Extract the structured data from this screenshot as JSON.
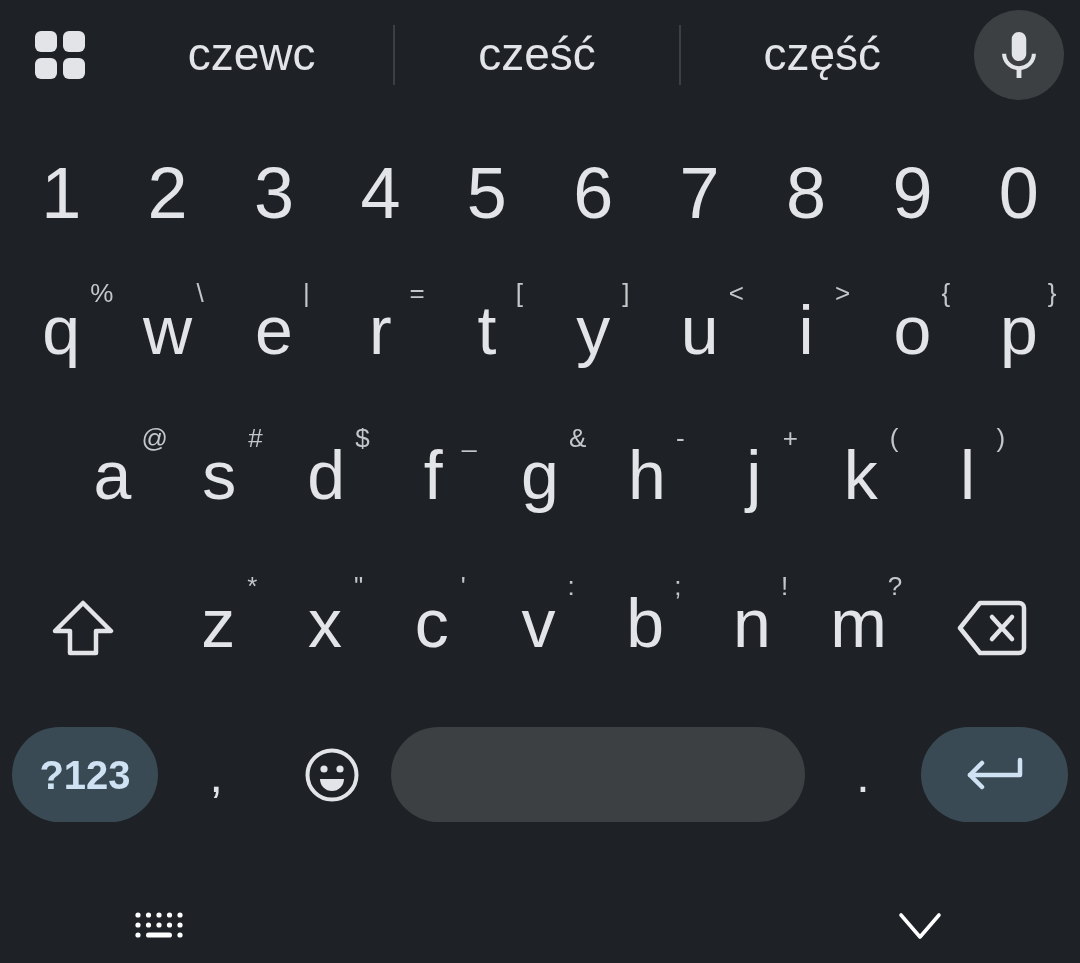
{
  "suggestion_strip": {
    "suggestions": [
      {
        "text": "czewc"
      },
      {
        "text": "cześć"
      },
      {
        "text": "część"
      }
    ]
  },
  "rows": [
    [
      {
        "kind": "digit",
        "label": "1"
      },
      {
        "kind": "digit",
        "label": "2"
      },
      {
        "kind": "digit",
        "label": "3"
      },
      {
        "kind": "digit",
        "label": "4"
      },
      {
        "kind": "digit",
        "label": "5"
      },
      {
        "kind": "digit",
        "label": "6"
      },
      {
        "kind": "digit",
        "label": "7"
      },
      {
        "kind": "digit",
        "label": "8"
      },
      {
        "kind": "digit",
        "label": "9"
      },
      {
        "kind": "digit",
        "label": "0"
      }
    ],
    [
      {
        "kind": "letter",
        "label": "q",
        "hint": "%"
      },
      {
        "kind": "letter",
        "label": "w",
        "hint": "\\"
      },
      {
        "kind": "letter",
        "label": "e",
        "hint": "|"
      },
      {
        "kind": "letter",
        "label": "r",
        "hint": "="
      },
      {
        "kind": "letter",
        "label": "t",
        "hint": "["
      },
      {
        "kind": "letter",
        "label": "y",
        "hint": "]"
      },
      {
        "kind": "letter",
        "label": "u",
        "hint": "<"
      },
      {
        "kind": "letter",
        "label": "i",
        "hint": ">"
      },
      {
        "kind": "letter",
        "label": "o",
        "hint": "{"
      },
      {
        "kind": "letter",
        "label": "p",
        "hint": "}"
      }
    ],
    [
      {
        "kind": "letter",
        "label": "a",
        "hint": "@"
      },
      {
        "kind": "letter",
        "label": "s",
        "hint": "#"
      },
      {
        "kind": "letter",
        "label": "d",
        "hint": "$"
      },
      {
        "kind": "letter",
        "label": "f",
        "hint": "_"
      },
      {
        "kind": "letter",
        "label": "g",
        "hint": "&"
      },
      {
        "kind": "letter",
        "label": "h",
        "hint": "-"
      },
      {
        "kind": "letter",
        "label": "j",
        "hint": "+"
      },
      {
        "kind": "letter",
        "label": "k",
        "hint": "("
      },
      {
        "kind": "letter",
        "label": "l",
        "hint": ")"
      }
    ],
    [
      {
        "kind": "shift"
      },
      {
        "kind": "letter",
        "label": "z",
        "hint": "*"
      },
      {
        "kind": "letter",
        "label": "x",
        "hint": "\""
      },
      {
        "kind": "letter",
        "label": "c",
        "hint": "'"
      },
      {
        "kind": "letter",
        "label": "v",
        "hint": ":"
      },
      {
        "kind": "letter",
        "label": "b",
        "hint": ";"
      },
      {
        "kind": "letter",
        "label": "n",
        "hint": "!"
      },
      {
        "kind": "letter",
        "label": "m",
        "hint": "?"
      },
      {
        "kind": "backspace"
      }
    ]
  ],
  "bottom_row": [
    {
      "kind": "mode",
      "label": "?123"
    },
    {
      "kind": "punct",
      "label": ","
    },
    {
      "kind": "emoji"
    },
    {
      "kind": "space"
    },
    {
      "kind": "punct",
      "label": "."
    },
    {
      "kind": "enter"
    }
  ]
}
